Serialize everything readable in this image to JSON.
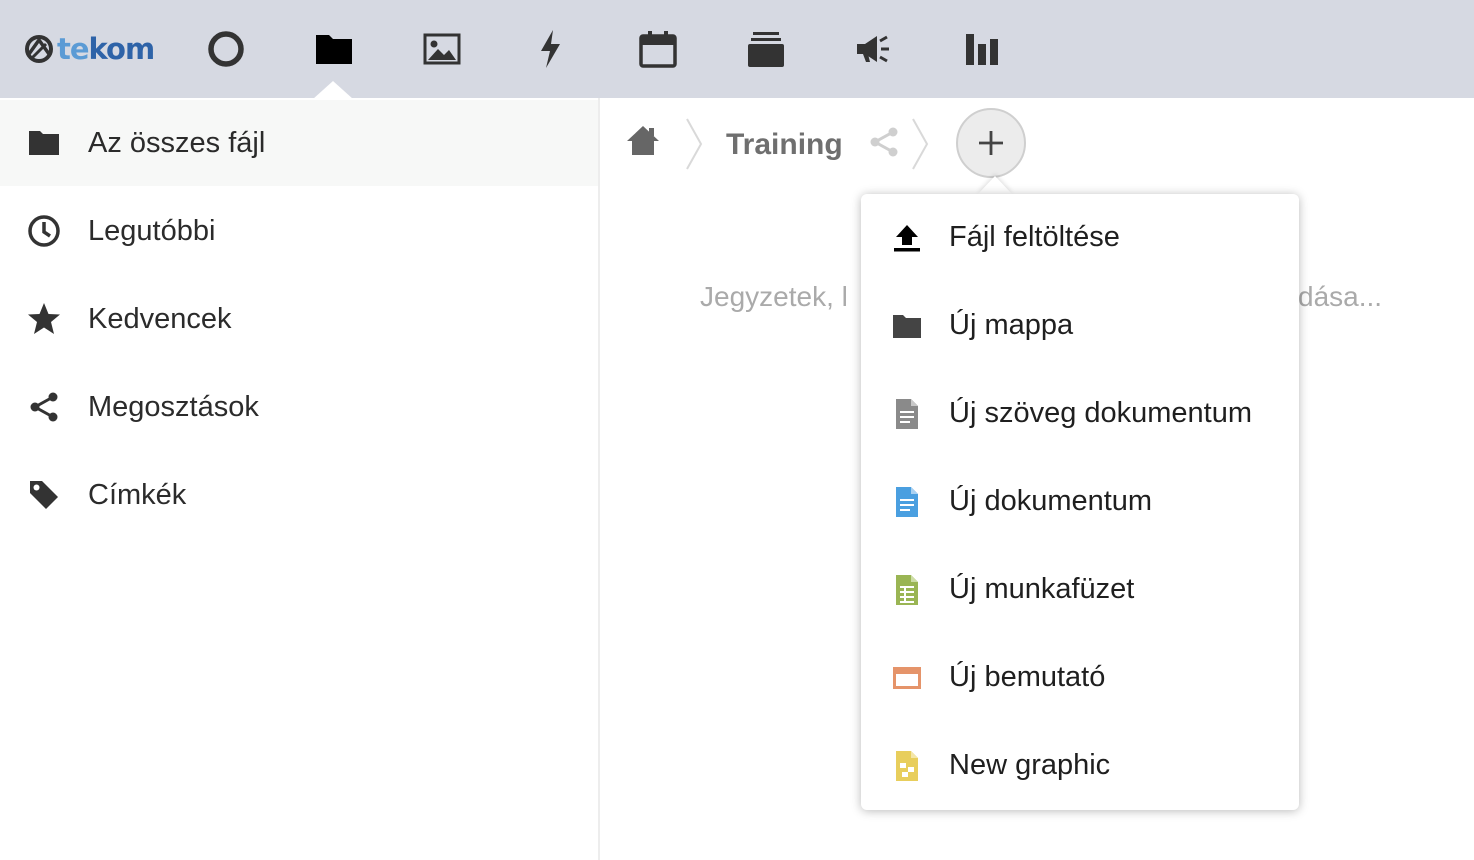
{
  "header": {
    "logo": {
      "prefix": "te",
      "suffix": "kom"
    },
    "apps": [
      {
        "name": "dashboard",
        "icon": "circle-icon"
      },
      {
        "name": "files",
        "icon": "folder-icon",
        "active": true
      },
      {
        "name": "photos",
        "icon": "image-icon"
      },
      {
        "name": "activity",
        "icon": "lightning-icon"
      },
      {
        "name": "calendar",
        "icon": "calendar-icon"
      },
      {
        "name": "deck",
        "icon": "stack-icon"
      },
      {
        "name": "announcements",
        "icon": "megaphone-icon"
      },
      {
        "name": "statistics",
        "icon": "bar-chart-icon"
      }
    ]
  },
  "sidebar": {
    "items": [
      {
        "label": "Az összes fájl",
        "icon": "folder-icon",
        "active": true
      },
      {
        "label": "Legutóbbi",
        "icon": "clock-icon"
      },
      {
        "label": "Kedvencek",
        "icon": "star-icon"
      },
      {
        "label": "Megosztások",
        "icon": "share-icon"
      },
      {
        "label": "Címkék",
        "icon": "tag-icon"
      }
    ]
  },
  "breadcrumb": {
    "home_icon": "home-icon",
    "current": "Training",
    "share_icon": "share-icon",
    "add_button_icon": "plus-icon"
  },
  "empty_hint": {
    "start": "Jegyzetek, l",
    "end": "dása..."
  },
  "new_menu": {
    "items": [
      {
        "label": "Fájl feltöltése",
        "icon": "upload-icon",
        "color": "#000000"
      },
      {
        "label": "Új mappa",
        "icon": "folder-icon",
        "color": "#444444"
      },
      {
        "label": "Új szöveg dokumentum",
        "icon": "text-file-icon",
        "color": "#8a8a8a"
      },
      {
        "label": "Új dokumentum",
        "icon": "document-icon",
        "color": "#4a9fe0"
      },
      {
        "label": "Új munkafüzet",
        "icon": "spreadsheet-icon",
        "color": "#9ab554"
      },
      {
        "label": "Új bemutató",
        "icon": "presentation-icon",
        "color": "#e5946a"
      },
      {
        "label": "New graphic",
        "icon": "graphic-icon",
        "color": "#e8ce5c"
      }
    ]
  },
  "colors": {
    "header_bg": "#d6d9e2",
    "logo_light": "#5b9bd5",
    "logo_dark": "#2e63a8",
    "active_nav_bg": "#f7f8f7"
  }
}
